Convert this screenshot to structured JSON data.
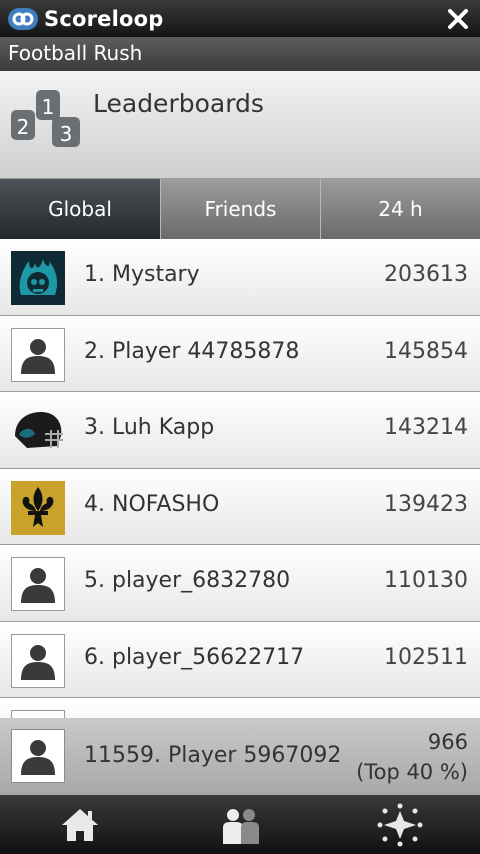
{
  "app": {
    "brand": "Scoreloop",
    "game_title": "Football Rush"
  },
  "header": {
    "title": "Leaderboards",
    "icon": "podium-rank-icon"
  },
  "tabs": [
    {
      "label": "Global",
      "active": true
    },
    {
      "label": "Friends",
      "active": false
    },
    {
      "label": "24 h",
      "active": false
    }
  ],
  "leaderboard": [
    {
      "name": "1. Mystary",
      "score": "203613",
      "avatar": "flaming-skull-avatar"
    },
    {
      "name": "2. Player 44785878",
      "score": "145854",
      "avatar": "default-user-avatar"
    },
    {
      "name": "3. Luh Kapp",
      "score": "143214",
      "avatar": "football-helmet-avatar"
    },
    {
      "name": "4. NOFASHO",
      "score": "139423",
      "avatar": "fleur-de-lis-avatar"
    },
    {
      "name": "5. player_6832780",
      "score": "110130",
      "avatar": "default-user-avatar"
    },
    {
      "name": "6. player_56622717",
      "score": "102511",
      "avatar": "default-user-avatar"
    }
  ],
  "current_user": {
    "name": "11559. Player 5967092",
    "score": "966",
    "percentile": "(Top 40 %)"
  },
  "bottom_nav": [
    {
      "icon": "home-icon"
    },
    {
      "icon": "users-icon"
    },
    {
      "icon": "sparkle-icon"
    }
  ],
  "colors": {
    "active_tab": "#2d3337",
    "accent_teal": "#1a6f7a",
    "gold": "#c8a22a"
  }
}
